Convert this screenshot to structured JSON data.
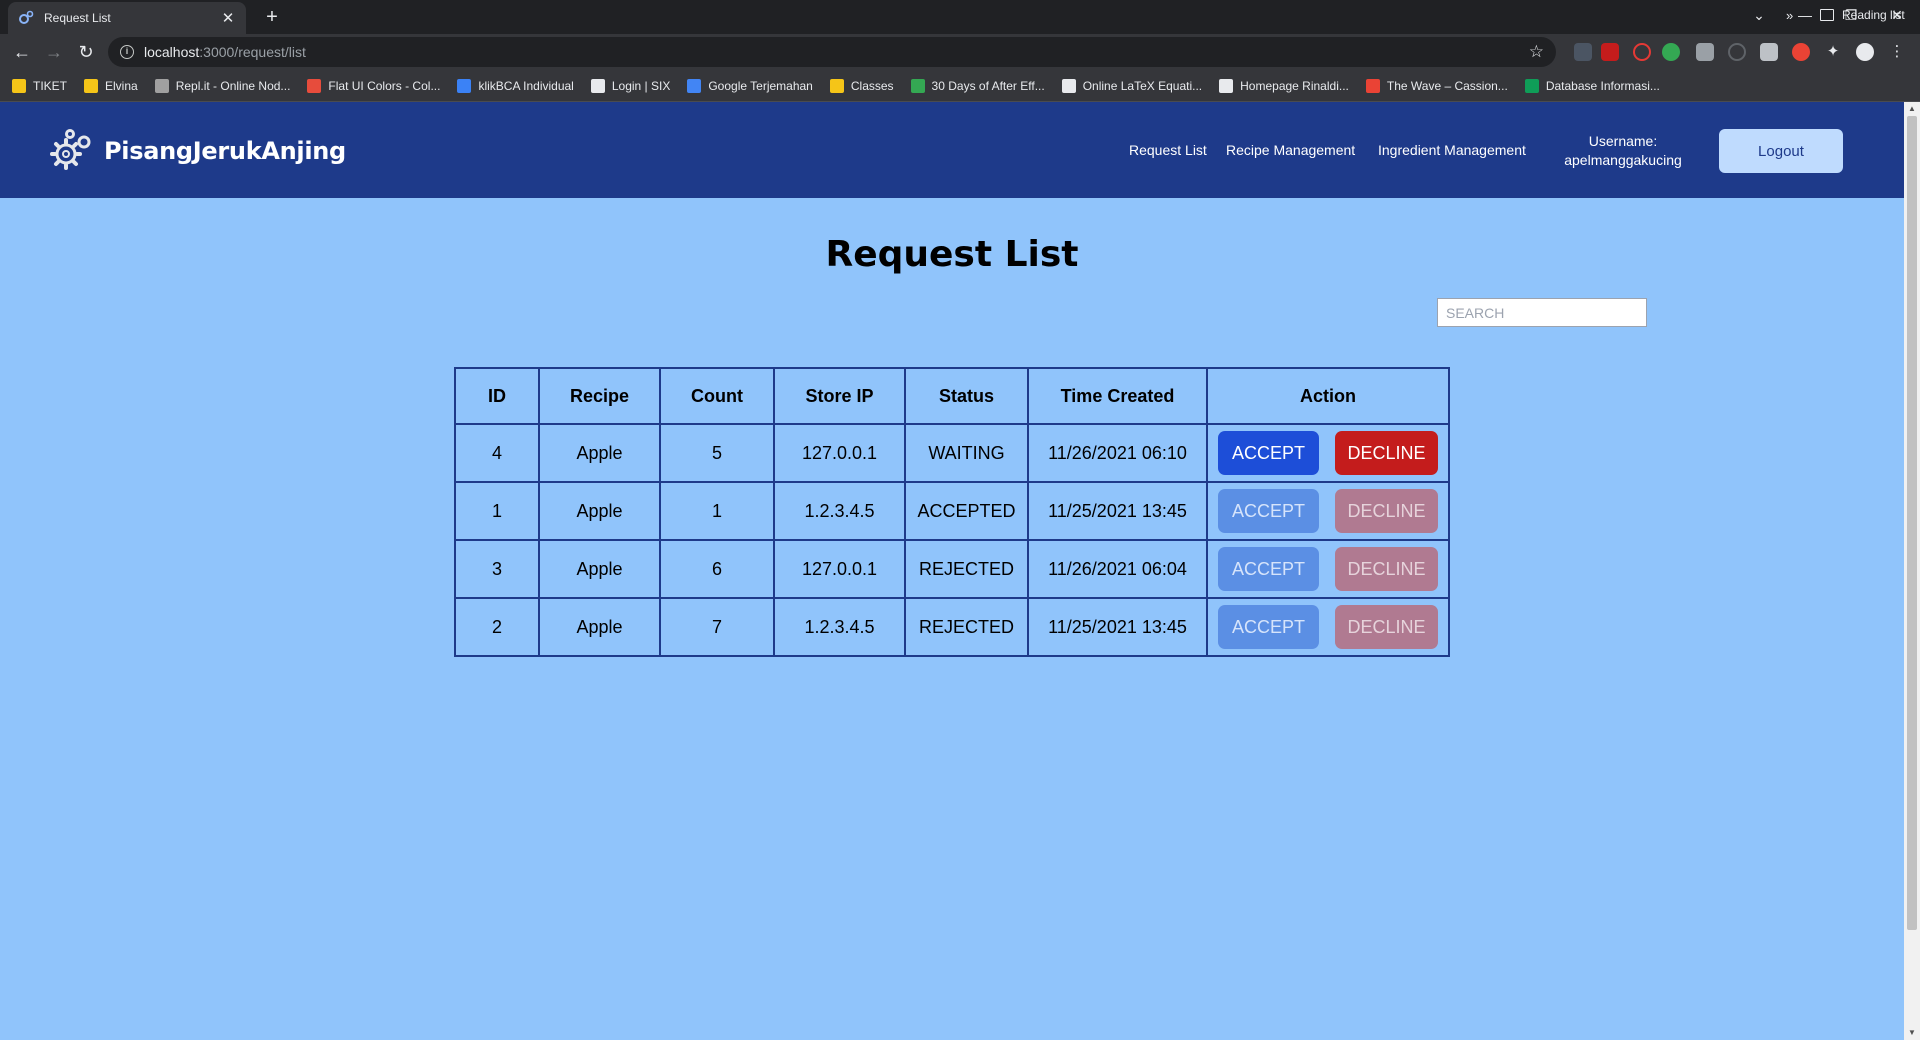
{
  "browser": {
    "tab_title": "Request List",
    "url_host": "localhost",
    "url_path": ":3000/request/list",
    "bookmarks": [
      {
        "label": "TIKET",
        "color": "#f5c518"
      },
      {
        "label": "Elvina",
        "color": "#f5c518"
      },
      {
        "label": "Repl.it - Online Nod...",
        "color": "#a0a0a0"
      },
      {
        "label": "Flat UI Colors - Col...",
        "color": "#e74c3c"
      },
      {
        "label": "klikBCA Individual",
        "color": "#3b82f6"
      },
      {
        "label": "Login | SIX",
        "color": "#e8eaed"
      },
      {
        "label": "Google Terjemahan",
        "color": "#4285f4"
      },
      {
        "label": "Classes",
        "color": "#f5c518"
      },
      {
        "label": "30 Days of After Eff...",
        "color": "#34a853"
      },
      {
        "label": "Online LaTeX Equati...",
        "color": "#e8eaed"
      },
      {
        "label": "Homepage Rinaldi...",
        "color": "#e8eaed"
      },
      {
        "label": "The Wave – Cassion...",
        "color": "#ea4335"
      },
      {
        "label": "Database Informasi...",
        "color": "#0f9d58"
      }
    ],
    "bookmarks_more": "»",
    "reading_list": "Reading list"
  },
  "navbar": {
    "brand": "PisangJerukAnjing",
    "links": [
      "Request List",
      "Recipe Management",
      "Ingredient Management"
    ],
    "username_label": "Username:",
    "username": "apelmanggakucing",
    "logout_label": "Logout",
    "bg_color": "#1e3a8a"
  },
  "page": {
    "title": "Request List",
    "search_placeholder": "SEARCH"
  },
  "table": {
    "headers": [
      "ID",
      "Recipe",
      "Count",
      "Store IP",
      "Status",
      "Time Created",
      "Action"
    ],
    "accept_label": "ACCEPT",
    "decline_label": "DECLINE",
    "rows": [
      {
        "id": "4",
        "recipe": "Apple",
        "count": "5",
        "ip": "127.0.0.1",
        "status": "WAITING",
        "time": "11/26/2021 06:10",
        "actions_enabled": true
      },
      {
        "id": "1",
        "recipe": "Apple",
        "count": "1",
        "ip": "1.2.3.4.5",
        "status": "ACCEPTED",
        "time": "11/25/2021 13:45",
        "actions_enabled": false
      },
      {
        "id": "3",
        "recipe": "Apple",
        "count": "6",
        "ip": "127.0.0.1",
        "status": "REJECTED",
        "time": "11/26/2021 06:04",
        "actions_enabled": false
      },
      {
        "id": "2",
        "recipe": "Apple",
        "count": "7",
        "ip": "1.2.3.4.5",
        "status": "REJECTED",
        "time": "11/25/2021 13:45",
        "actions_enabled": false
      }
    ]
  }
}
